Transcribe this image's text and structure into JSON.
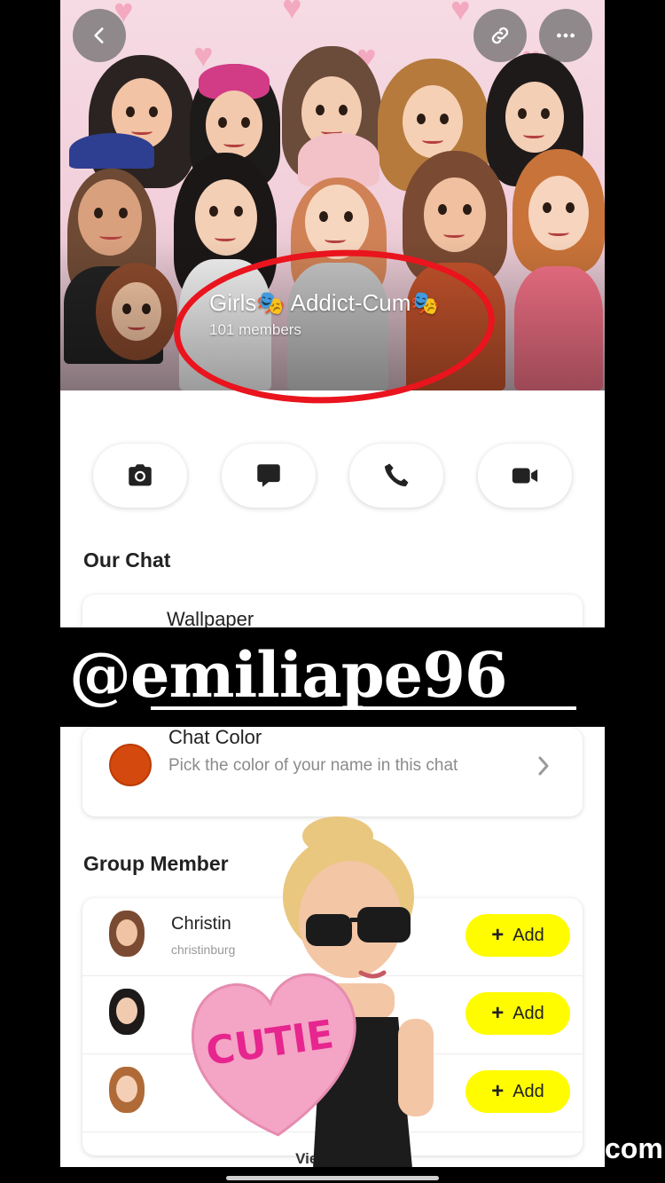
{
  "header": {
    "group_name": "Girls🎭 Addict-Cum🎭",
    "member_count": "101 members",
    "back_icon": "back-chevron-icon",
    "link_icon": "link-icon",
    "more_icon": "more-dots-icon"
  },
  "actions": [
    {
      "name": "camera",
      "icon": "camera-icon"
    },
    {
      "name": "chat",
      "icon": "chat-bubble-icon"
    },
    {
      "name": "call",
      "icon": "phone-icon"
    },
    {
      "name": "video",
      "icon": "video-camera-icon"
    }
  ],
  "our_chat": {
    "title": "Our Chat",
    "wallpaper_label": "Wallpaper",
    "chat_color_title": "Chat Color",
    "chat_color_subtitle": "Pick the color of your name in this chat",
    "chat_color_value": "#d4490d"
  },
  "overlay": {
    "handle": "@emiliape96",
    "sticker_text": "CUTIE",
    "watermark": "com"
  },
  "members": {
    "title": "Group Member",
    "add_label": "Add",
    "rows": [
      {
        "name": "Christin",
        "username": "christinburg"
      },
      {
        "name": "",
        "username": ""
      },
      {
        "name": "",
        "username": ""
      }
    ],
    "view_more": "View More"
  },
  "colors": {
    "add_button": "#fffc00",
    "annotation_circle": "#e9141d"
  }
}
